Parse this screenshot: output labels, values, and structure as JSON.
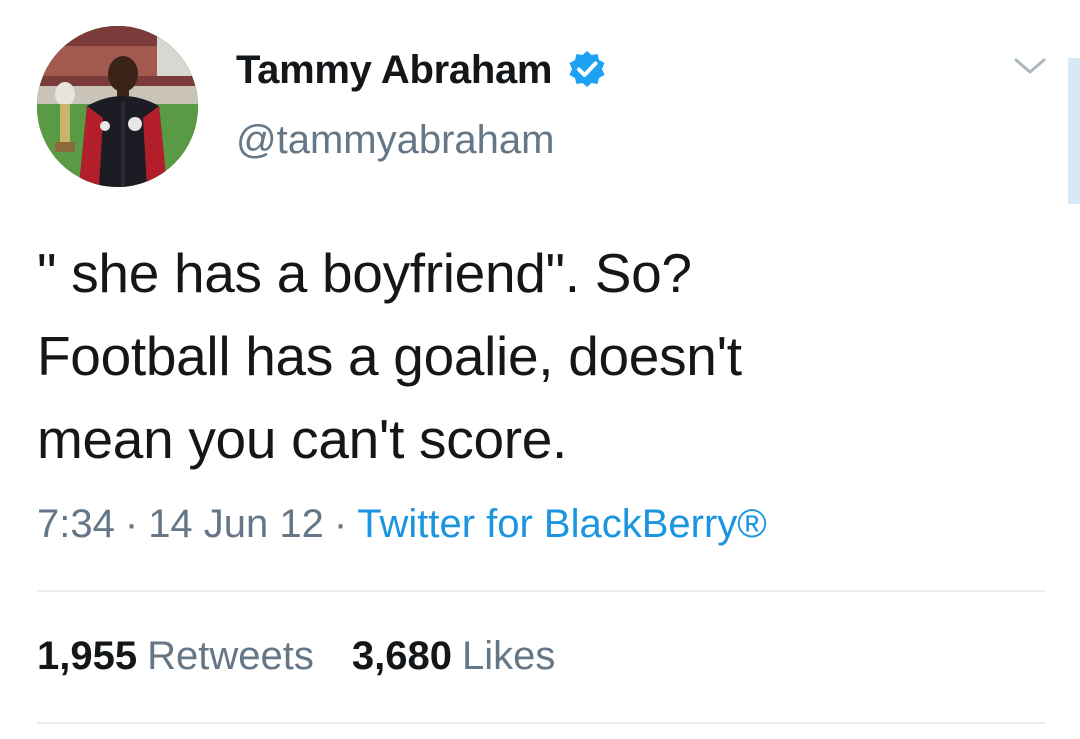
{
  "tweet": {
    "author": {
      "display_name": "Tammy Abraham",
      "handle": "@tammyabraham",
      "verified_icon": "verified-badge-icon",
      "avatar": "profile-photo"
    },
    "text": "\" she has a boyfriend\". So?\nFootball has a goalie, doesn't\nmean you can't score.",
    "time": "7:34",
    "date": "14 Jun 12",
    "separator": "·",
    "source": "Twitter for BlackBerry®",
    "stats": {
      "retweets_count": "1,955",
      "retweets_label": "Retweets",
      "likes_count": "3,680",
      "likes_label": "Likes"
    },
    "menu_icon": "chevron-down-icon"
  },
  "colors": {
    "text_primary": "#14171a",
    "text_secondary": "#657786",
    "link": "#1b95e0",
    "verified": "#1da1f2",
    "divider": "#e6ecf0"
  }
}
